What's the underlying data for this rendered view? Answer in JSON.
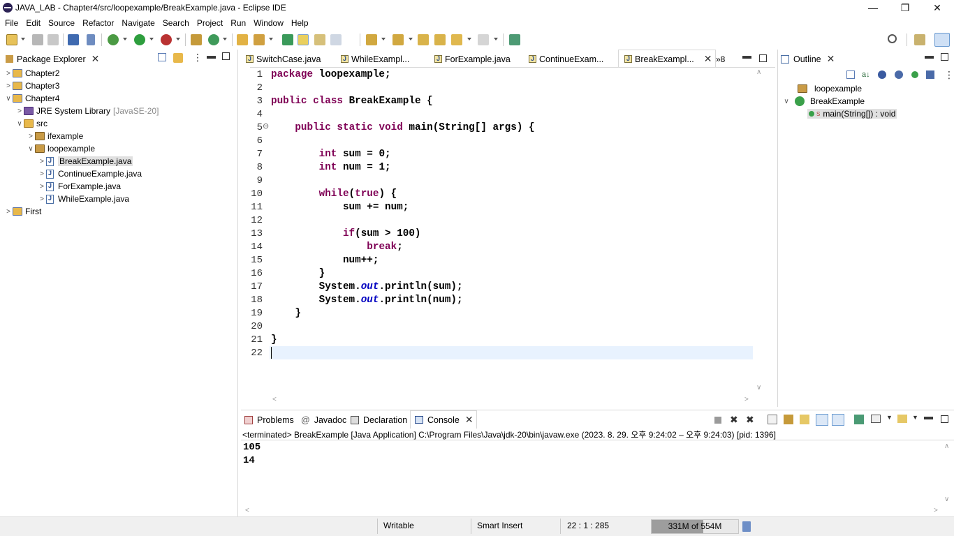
{
  "window": {
    "title": "JAVA_LAB - Chapter4/src/loopexample/BreakExample.java - Eclipse IDE",
    "controls": {
      "minimize": "—",
      "restore": "❐",
      "close": "✕"
    }
  },
  "menu": [
    "File",
    "Edit",
    "Source",
    "Refactor",
    "Navigate",
    "Search",
    "Project",
    "Run",
    "Window",
    "Help"
  ],
  "package_explorer": {
    "title": "Package Explorer",
    "items": [
      {
        "label": "Chapter2",
        "type": "project",
        "expanded": false
      },
      {
        "label": "Chapter3",
        "type": "project",
        "expanded": false
      },
      {
        "label": "Chapter4",
        "type": "project",
        "expanded": true
      },
      {
        "label": "JRE System Library",
        "suffix": "[JavaSE-20]",
        "type": "library"
      },
      {
        "label": "src",
        "type": "folder",
        "expanded": true
      },
      {
        "label": "ifexample",
        "type": "package"
      },
      {
        "label": "loopexample",
        "type": "package",
        "expanded": true
      },
      {
        "label": "BreakExample.java",
        "type": "java",
        "selected": true
      },
      {
        "label": "ContinueExample.java",
        "type": "java"
      },
      {
        "label": "ForExample.java",
        "type": "java"
      },
      {
        "label": "WhileExample.java",
        "type": "java"
      },
      {
        "label": "First",
        "type": "project",
        "expanded": false
      }
    ]
  },
  "editor": {
    "tabs": [
      "SwitchCase.java",
      "WhileExampl...",
      "ForExample.java",
      "ContinueExam...",
      "BreakExampl..."
    ],
    "active_tab": "BreakExampl...",
    "overflow_label": "»8",
    "line_numbers": [
      "1",
      "2",
      "3",
      "4",
      "5",
      "6",
      "7",
      "8",
      "9",
      "10",
      "11",
      "12",
      "13",
      "14",
      "15",
      "16",
      "17",
      "18",
      "19",
      "20",
      "21",
      "22"
    ],
    "fold_marker": "⊖",
    "lines": [
      "package loopexample;",
      "",
      "public class BreakExample {",
      "",
      "    public static void main(String[] args) {",
      "",
      "        int sum = 0;",
      "        int num = 1;",
      "",
      "        while(true) {",
      "            sum += num;",
      "",
      "            if(sum > 100)",
      "                break;",
      "            num++;",
      "        }",
      "        System.out.println(sum);",
      "        System.out.println(num);",
      "    }",
      "",
      "}",
      ""
    ]
  },
  "outline": {
    "title": "Outline",
    "items": [
      {
        "label": "loopexample",
        "type": "package"
      },
      {
        "label": "BreakExample",
        "type": "class"
      },
      {
        "label": "main(String[]) : void",
        "type": "method",
        "selected": true,
        "modifier": "S"
      }
    ]
  },
  "bottom_panel": {
    "tabs": [
      "Problems",
      "Javadoc",
      "Declaration",
      "Console"
    ],
    "active_tab": "Console",
    "javadoc_prefix": "@",
    "console_header": "<terminated> BreakExample [Java Application] C:\\Program Files\\Java\\jdk-20\\bin\\javaw.exe  (2023. 8. 29. 오후 9:24:02 – 오후 9:24:03) [pid: 1396]",
    "output": [
      "105",
      "14"
    ]
  },
  "status": {
    "writable": "Writable",
    "insert_mode": "Smart Insert",
    "position": "22 : 1 : 285",
    "heap": "331M of 554M",
    "heap_used_fraction": 0.6
  },
  "colors": {
    "keyword": "#7f0055",
    "field": "#0000c0",
    "current_line": "#e8f2fe",
    "selection": "#e0e0e0"
  }
}
